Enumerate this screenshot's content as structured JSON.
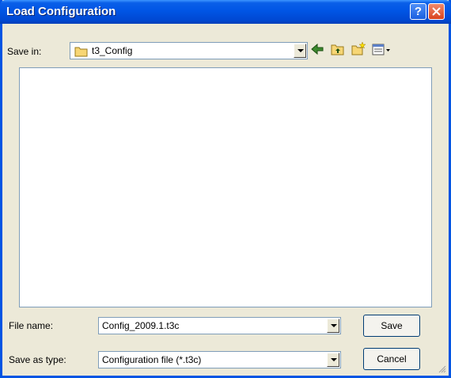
{
  "window": {
    "title": "Load Configuration"
  },
  "titlebar": {
    "help_label": "?"
  },
  "save_in": {
    "label": "Save in:",
    "value": "t3_Config"
  },
  "file_name": {
    "label": "File name:",
    "value": "Config_2009.1.t3c"
  },
  "save_type": {
    "label": "Save as type:",
    "value": "Configuration file (*.t3c)"
  },
  "buttons": {
    "save": "Save",
    "cancel": "Cancel"
  },
  "colors": {
    "titlebar": "#0055e5",
    "face": "#ece9d8",
    "close": "#d9431d",
    "border": "#7f9db9"
  }
}
